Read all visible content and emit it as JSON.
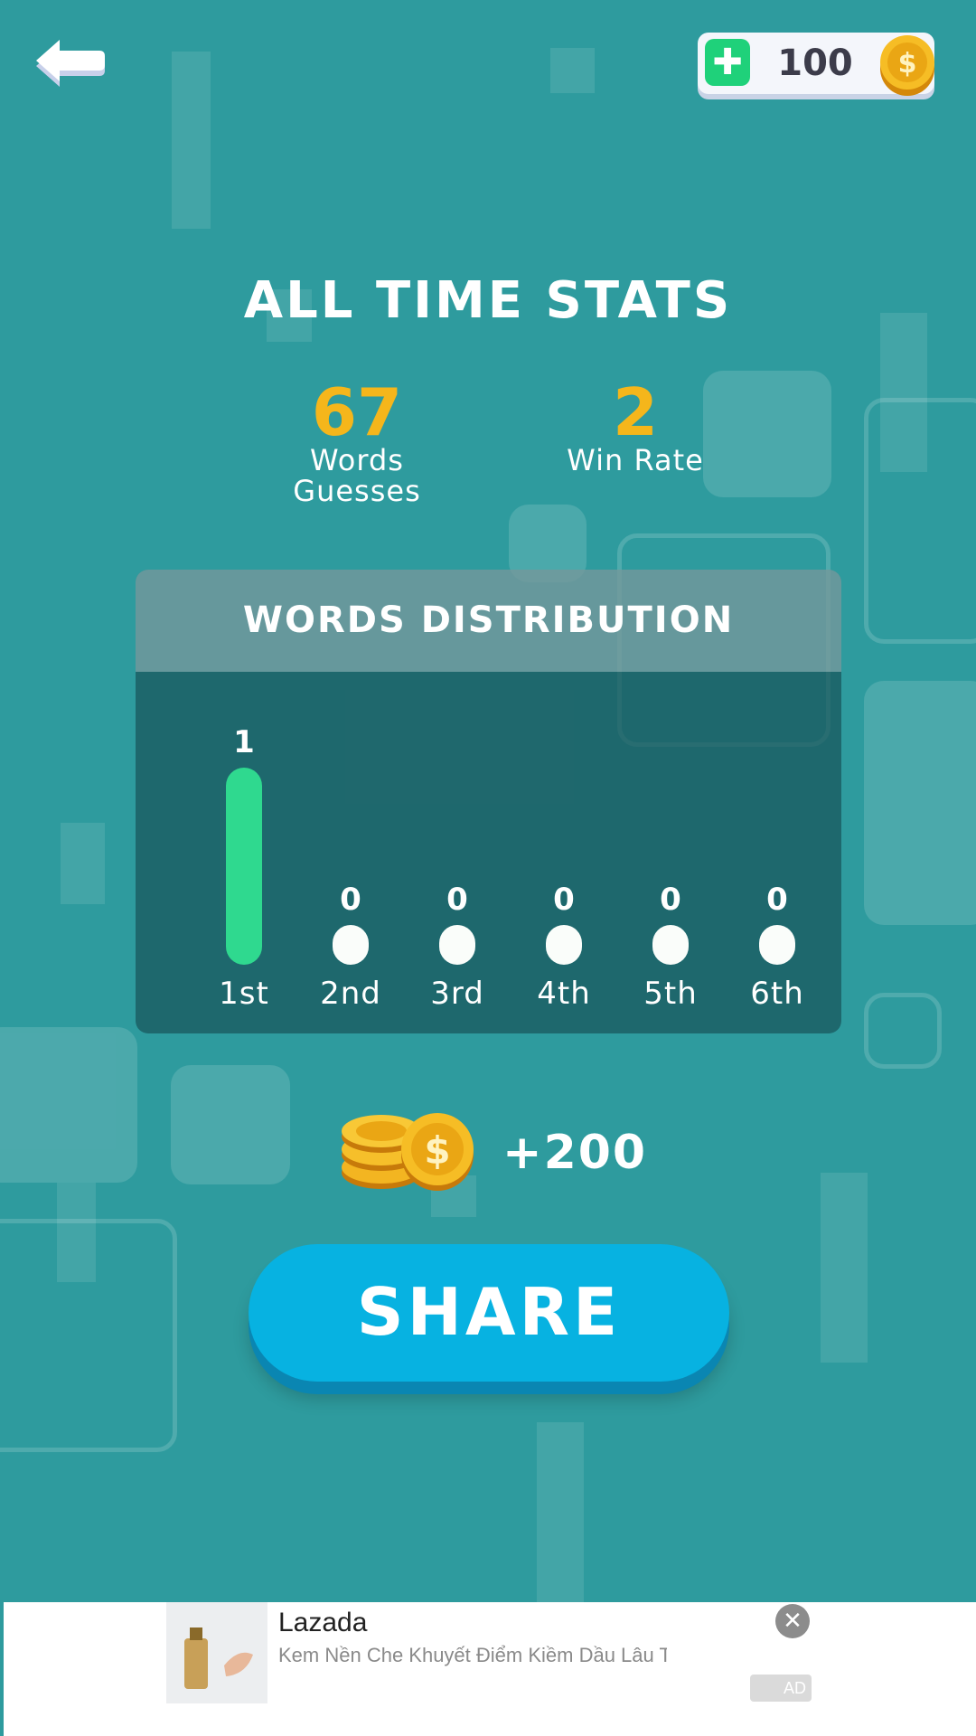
{
  "topbar": {
    "back_icon": "back-arrow-icon",
    "add_coins_icon": "plus-icon",
    "coin_count": "100",
    "coin_icon": "coin-icon",
    "plus_symbol": "✚"
  },
  "stats": {
    "title": "ALL TIME STATS",
    "words_guessed_value": "67",
    "words_guessed_label_1": "Words",
    "words_guessed_label_2": "Guesses",
    "win_rate_value": "2",
    "win_rate_label": "Win Rate"
  },
  "distribution": {
    "title": "WORDS DISTRIBUTION",
    "active_color": "#2fd98f",
    "bars": [
      {
        "label": "1st",
        "count": "1"
      },
      {
        "label": "2nd",
        "count": "0"
      },
      {
        "label": "3rd",
        "count": "0"
      },
      {
        "label": "4th",
        "count": "0"
      },
      {
        "label": "5th",
        "count": "0"
      },
      {
        "label": "6th",
        "count": "0"
      }
    ]
  },
  "reward": {
    "amount": "+200",
    "icon": "coin-stack-icon"
  },
  "share": {
    "label": "SHARE",
    "color": "#07b2e1"
  },
  "ad": {
    "title": "Lazada",
    "subtitle": "Kem Nền Che Khuyết Điểm Kiềm Dầu Lâu T",
    "badge": "AD",
    "close_symbol": "✕"
  },
  "colors": {
    "background": "#2e9b9e",
    "stat_value": "#f5b61b"
  }
}
